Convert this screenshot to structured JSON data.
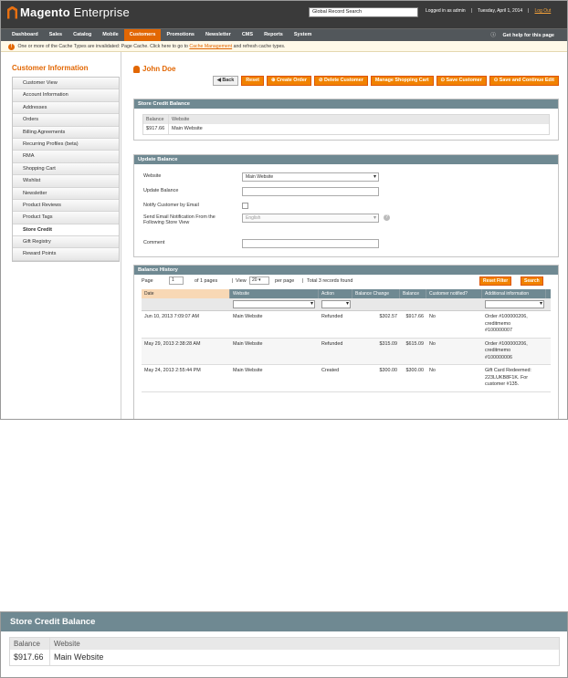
{
  "header": {
    "logo_bold": "Magento",
    "logo_light": "Enterprise",
    "global_search": "Global Record Search",
    "logged_in": "Logged in as admin",
    "date": "Tuesday, April 1, 2014",
    "logout": "Log Out"
  },
  "nav": {
    "items": [
      "Dashboard",
      "Sales",
      "Catalog",
      "Mobile",
      "Customers",
      "Promotions",
      "Newsletter",
      "CMS",
      "Reports",
      "System"
    ],
    "active_index": 4,
    "help": "Get help for this page"
  },
  "message": {
    "text_before": "One or more of the Cache Types are invalidated: Page Cache. Click here to go to",
    "link": "Cache Management",
    "text_after": "and refresh cache types."
  },
  "sidebar": {
    "title": "Customer Information",
    "items": [
      "Customer View",
      "Account Information",
      "Addresses",
      "Orders",
      "Billing Agreements",
      "Recurring Profiles (beta)",
      "RMA",
      "Shopping Cart",
      "Wishlist",
      "Newsletter",
      "Product Reviews",
      "Product Tags",
      "Store Credit",
      "Gift Registry",
      "Reward Points"
    ],
    "active_index": 12
  },
  "page": {
    "title": "John Doe",
    "buttons": {
      "back": "Back",
      "reset": "Reset",
      "create_order": "Create Order",
      "delete": "Delete Customer",
      "manage_cart": "Manage Shopping Cart",
      "save": "Save Customer",
      "save_continue": "Save and Continue Edit"
    }
  },
  "store_credit": {
    "header": "Store Credit Balance",
    "col_balance": "Balance",
    "col_website": "Website",
    "balance": "$917.66",
    "website": "Main Website"
  },
  "update_balance": {
    "header": "Update Balance",
    "website_label": "Website",
    "website_value": "Main Website",
    "update_label": "Update Balance",
    "notify_label": "Notify Customer by Email",
    "store_view_label_1": "Send Email Notification From the",
    "store_view_label_2": "Following Store View",
    "store_view_value": "English",
    "comment_label": "Comment"
  },
  "history": {
    "header": "Balance History",
    "page_label": "Page",
    "page_value": "1",
    "of_pages": "of 1 pages",
    "view_label": "View",
    "per_page_value": "20",
    "per_page_label": "per page",
    "total": "Total 3 records found",
    "reset_filter": "Reset Filter",
    "search": "Search",
    "columns": [
      "Date",
      "Website",
      "Action",
      "Balance Change",
      "Balance",
      "Customer notified?",
      "Additional information"
    ],
    "rows": [
      [
        "Jun 10, 2013 7:09:07 AM",
        "Main Website",
        "Refunded",
        "$302.57",
        "$917.66",
        "No",
        "Order #100000206,\ncreditmemo\n#100000007"
      ],
      [
        "May 29, 2013 2:38:28 AM",
        "Main Website",
        "Refunded",
        "$315.09",
        "$615.09",
        "No",
        "Order #100000206,\ncreditmemo\n#100000006"
      ],
      [
        "May 24, 2013 2:55:44 PM",
        "Main Website",
        "Created",
        "$300.00",
        "$300.00",
        "No",
        "Gift Card Redeemed:\n223LUKB8F1K. For\ncustomer #135."
      ]
    ]
  },
  "zoom": {
    "header": "Store Credit Balance",
    "col_balance": "Balance",
    "col_website": "Website",
    "balance": "$917.66",
    "website": "Main Website"
  }
}
